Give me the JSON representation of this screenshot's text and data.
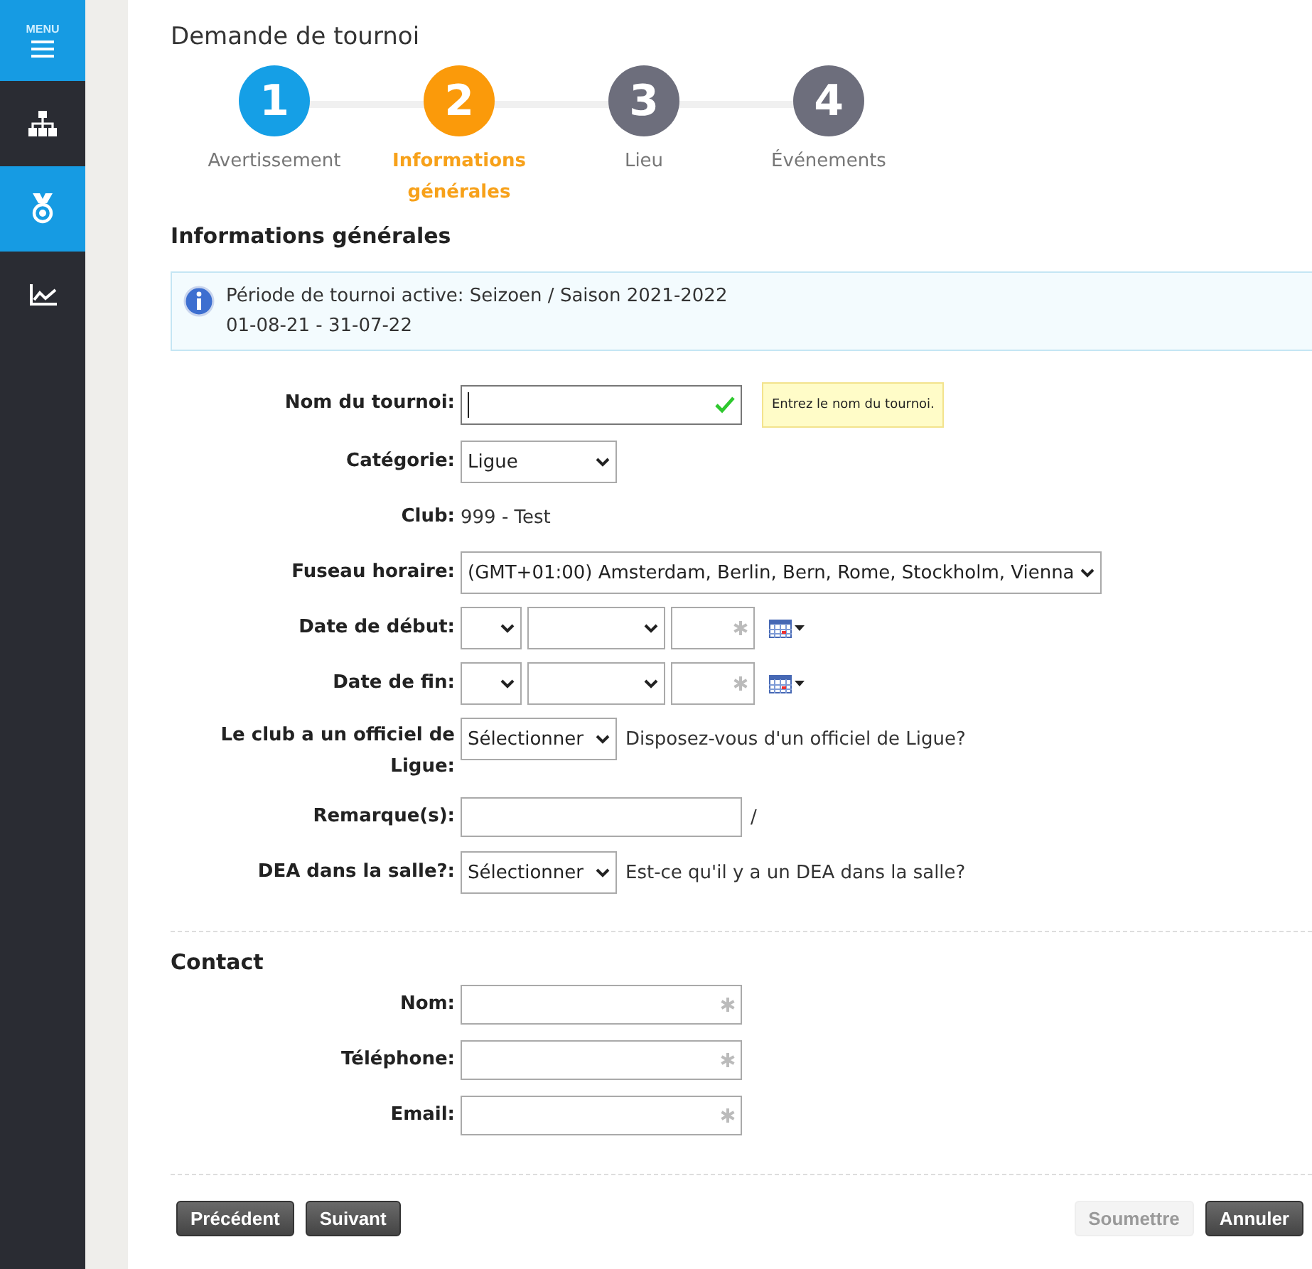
{
  "sidebar": {
    "menu_label": "MENU",
    "items": [
      {
        "selected": false
      },
      {
        "selected": true
      },
      {
        "selected": false
      }
    ]
  },
  "title": "Demande de tournoi",
  "steps": [
    {
      "number": "1",
      "label": "Avertissement",
      "completed": true,
      "selected": false
    },
    {
      "number": "2",
      "label": "Informations générales",
      "completed": false,
      "selected": true
    },
    {
      "number": "3",
      "label": "Lieu",
      "completed": false,
      "selected": false
    },
    {
      "number": "4",
      "label": "Événements",
      "completed": false,
      "selected": false
    }
  ],
  "section_title": "Informations générales",
  "info": {
    "lines": [
      "Période de tournoi active: Seizoen / Saison 2021-2022",
      "01-08-21 - 31-07-22"
    ]
  },
  "fields": [
    {
      "kind": "text",
      "label": "Nom du tournoi:",
      "valid": true,
      "focused": true,
      "tooltip": "Entrez le nom du tournoi."
    },
    {
      "kind": "select",
      "label": "Catégorie:",
      "value": "Ligue"
    },
    {
      "kind": "static",
      "label": "Club:",
      "value": "999 - Test"
    },
    {
      "kind": "select",
      "label": "Fuseau horaire:",
      "value": "(GMT+01:00) Amsterdam, Berlin, Bern, Rome, Stockholm, Vienna"
    },
    {
      "kind": "date",
      "label": "Date de début:",
      "required": true
    },
    {
      "kind": "date",
      "label": "Date de fin:",
      "required": true
    },
    {
      "kind": "select",
      "label": "Le club a un officiel de Ligue:",
      "value": "Sélectionner",
      "hint": "Disposez-vous d'un officiel de Ligue?"
    },
    {
      "kind": "text",
      "label": "Remarque(s):",
      "valid": false,
      "focused": false,
      "suffix": "/"
    },
    {
      "kind": "select",
      "label": "DEA dans la salle?:",
      "value": "Sélectionner",
      "hint": "Est-ce qu'il y a un DEA dans la salle?"
    }
  ],
  "contact": {
    "title": "Contact",
    "fields": [
      {
        "label": "Nom:",
        "required": true
      },
      {
        "label": "Téléphone:",
        "required": true
      },
      {
        "label": "Email:",
        "required": true
      }
    ]
  },
  "buttons": [
    {
      "label": "Précédent",
      "disabled": false
    },
    {
      "label": "Suivant",
      "disabled": false
    },
    {
      "label": "Soumettre",
      "disabled": true
    },
    {
      "label": "Annuler",
      "disabled": false
    }
  ]
}
